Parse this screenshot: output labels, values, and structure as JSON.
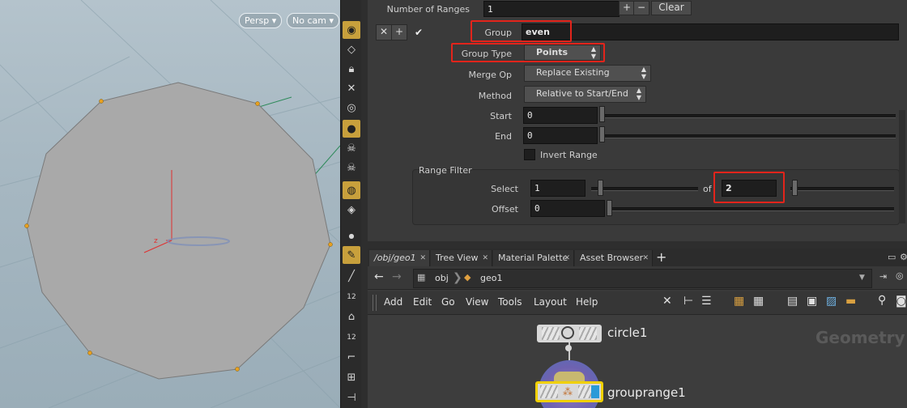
{
  "viewport": {
    "persp_label": "Persp",
    "cam_label": "No cam",
    "axis_label": "z"
  },
  "params": {
    "number_of_ranges": {
      "label": "Number of Ranges",
      "value": "1",
      "clear_label": "Clear"
    },
    "group": {
      "label": "Group",
      "value": "even"
    },
    "group_type": {
      "label": "Group Type",
      "value": "Points"
    },
    "merge_op": {
      "label": "Merge Op",
      "value": "Replace Existing"
    },
    "method": {
      "label": "Method",
      "value": "Relative to Start/End"
    },
    "start": {
      "label": "Start",
      "value": "0"
    },
    "end": {
      "label": "End",
      "value": "0"
    },
    "invert_range": {
      "label": "Invert Range"
    },
    "range_filter": {
      "title": "Range Filter",
      "select_label": "Select",
      "select_value": "1",
      "of_label": "of",
      "of_value": "2",
      "offset_label": "Offset",
      "offset_value": "0"
    }
  },
  "tabs": [
    {
      "label": "/obj/geo1"
    },
    {
      "label": "Tree View"
    },
    {
      "label": "Material Palette"
    },
    {
      "label": "Asset Browser"
    }
  ],
  "path": {
    "root": "obj",
    "current": "geo1"
  },
  "menu": [
    "Add",
    "Edit",
    "Go",
    "View",
    "Tools",
    "Layout",
    "Help"
  ],
  "network": {
    "watermark": "Geometry",
    "nodes": [
      {
        "name": "circle1"
      },
      {
        "name": "grouprange1"
      }
    ]
  },
  "shelf_tools": [
    "visibility-icon",
    "display-icon",
    "lock-icon",
    "snap-icon",
    "shading-icon",
    "light-icon",
    "skull-icon",
    "skull2-icon",
    "camera-icon",
    "render-icon",
    "dot-icon",
    "select-tool-icon",
    "pen-icon",
    "number-12-icon",
    "brush-icon",
    "number-12b-icon",
    "corner-icon",
    "transform-icon",
    "handle-icon"
  ],
  "colors": {
    "highlight": "#e3241b",
    "shelf_active": "#c8a03c",
    "node_selected": "#f0d000"
  }
}
